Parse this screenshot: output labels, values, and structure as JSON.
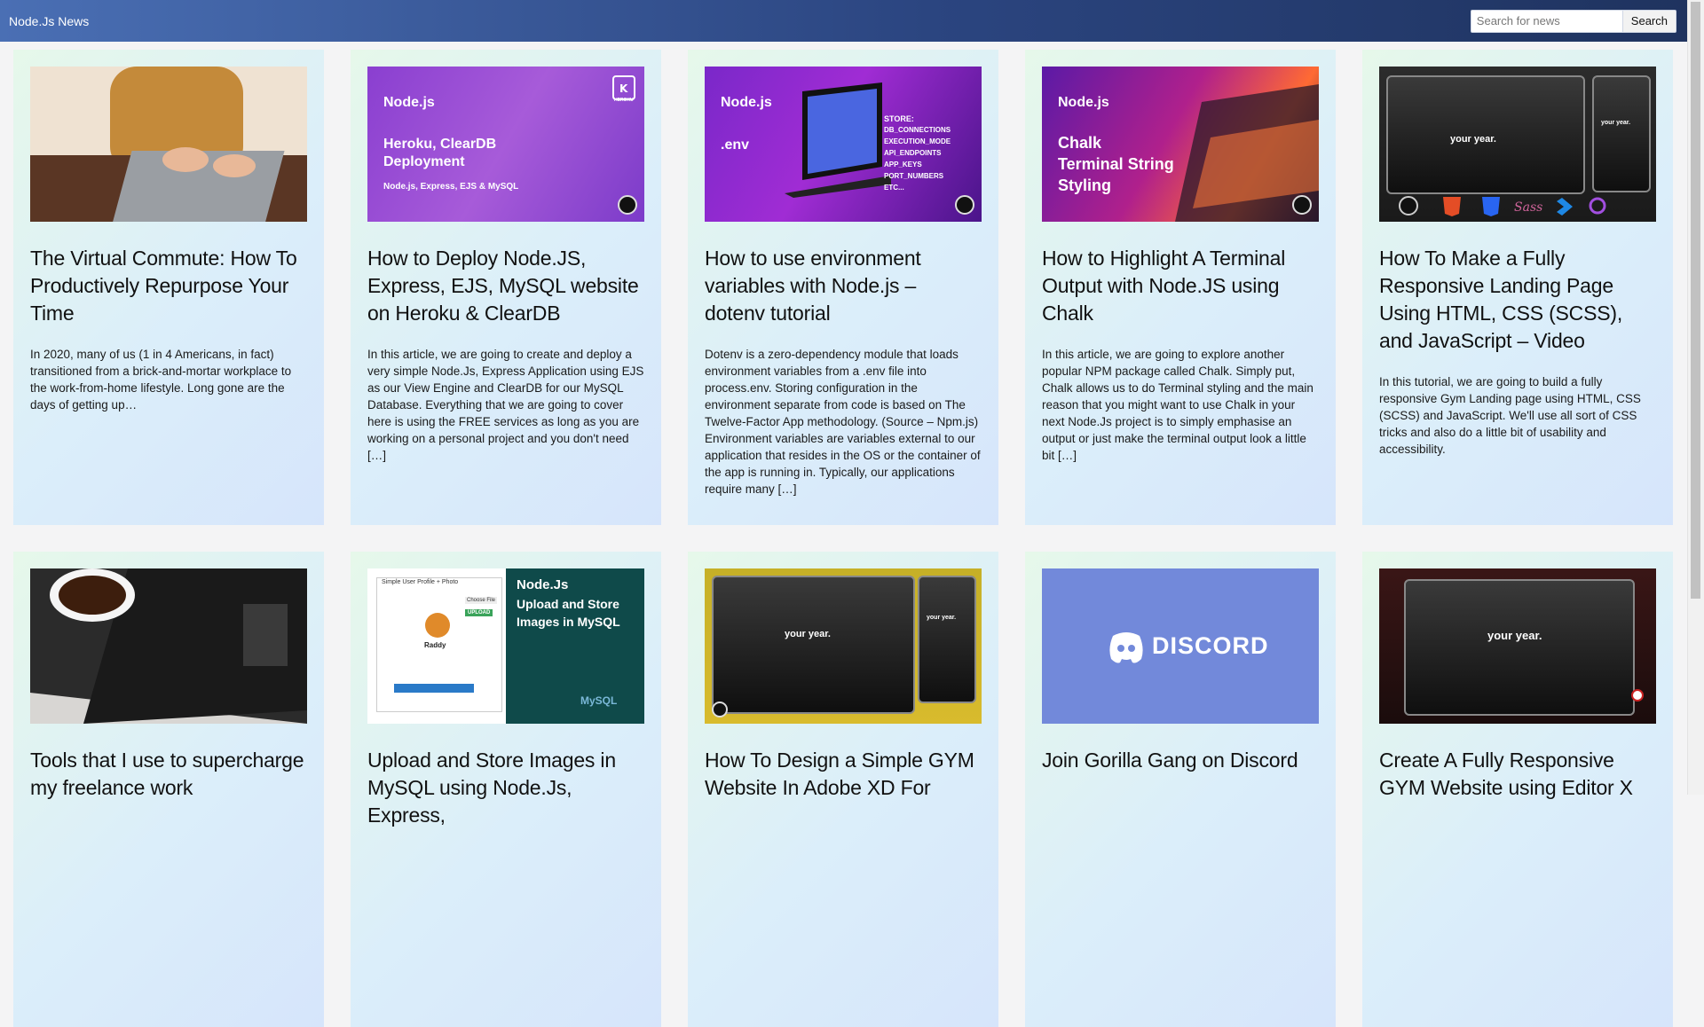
{
  "header": {
    "brand": "Node.Js News",
    "search_placeholder": "Search for news",
    "search_button": "Search"
  },
  "posts": [
    {
      "title": "The Virtual Commute: How To Productively Repurpose Your Time",
      "excerpt": "In 2020, many of us (1 in 4 Americans, in fact) transitioned from a brick-and-mortar workplace to the work-from-home lifestyle. Long gone are the days of getting up…",
      "image_text": []
    },
    {
      "title": "How to Deploy Node.JS, Express, EJS, MySQL website on Heroku & ClearDB",
      "excerpt": "In this article, we are going to create and deploy a very simple Node.Js, Express Application using EJS as our View Engine and ClearDB for our MySQL Database. Everything that we are going to cover here is using the FREE services as long as you are working on a personal project and you don't need […]",
      "image_text": [
        "Node.js",
        "Heroku, ClearDB Deployment",
        "Node.js, Express, EJS & MySQL",
        "HEROKU"
      ]
    },
    {
      "title": "How to use environment variables with Node.js – dotenv tutorial",
      "excerpt": "Dotenv is a zero-dependency module that loads environment variables from a .env file into process.env. Storing configuration in the environment separate from code is based on The Twelve-Factor App methodology. (Source – Npm.js) Environment variables are variables external to our application that resides in the OS or the container of the app is running in. Typically, our applications require many […]",
      "image_text": [
        "Node.js",
        ".env",
        "STORE:",
        "DB_CONNECTIONS",
        "EXECUTION_MODE",
        "API_ENDPOINTS",
        "APP_KEYS",
        "PORT_NUMBERS",
        "ETC..."
      ]
    },
    {
      "title": "How to Highlight A Terminal Output with Node.JS using Chalk",
      "excerpt": "In this article, we are going to explore another popular NPM package called Chalk. Simply put, Chalk allows us to do Terminal styling and the main reason that you might want to use Chalk in your next Node.Js project is to simply emphasise an output or just make the terminal output look a little bit […]",
      "image_text": [
        "Node.js",
        "Chalk",
        "Terminal String",
        "Styling"
      ]
    },
    {
      "title": "How To Make a Fully Responsive Landing Page Using HTML, CSS (SCSS), and JavaScript – Video",
      "excerpt": "In this tutorial, we are going to build a fully responsive Gym Landing page using HTML, CSS (SCSS) and JavaScript. We'll use all sort of CSS tricks and also do a little bit of usability and accessibility.",
      "image_text": [
        "your year.",
        "your year."
      ]
    },
    {
      "title": "Tools that I use to supercharge my freelance work",
      "excerpt": "",
      "image_text": []
    },
    {
      "title": "Upload and Store Images in MySQL using Node.Js, Express,",
      "excerpt": "",
      "image_text": [
        "Simple User Profile + Photo",
        "Choose File",
        "UPLOAD",
        "Raddy",
        "Node.Js",
        "Upload and Store",
        "Images in MySQL",
        "MySQL"
      ]
    },
    {
      "title": "How To Design a Simple GYM Website In Adobe XD For",
      "excerpt": "",
      "image_text": [
        "your year.",
        "your year."
      ]
    },
    {
      "title": "Join Gorilla Gang on Discord",
      "excerpt": "",
      "image_text": [
        "DISCORD"
      ]
    },
    {
      "title": "Create A Fully Responsive GYM Website using Editor X",
      "excerpt": "",
      "image_text": [
        "your year."
      ]
    }
  ],
  "colors": {
    "header_start": "#4a6fb4",
    "header_end": "#1f335f",
    "card_bg_start": "#e6f8ea",
    "card_bg_end": "#d6e5fb"
  }
}
